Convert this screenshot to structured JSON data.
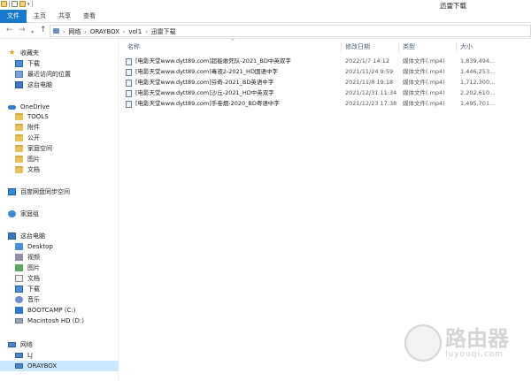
{
  "window": {
    "title": "迅雷下载"
  },
  "ribbon": {
    "tabs": [
      "文件",
      "主页",
      "共享",
      "查看"
    ]
  },
  "address": {
    "crumbs": [
      "网络",
      "ORAYBOX",
      "vol1",
      "迅雷下载"
    ]
  },
  "nav": {
    "favorites": {
      "label": "收藏夹",
      "items": [
        "下载",
        "最近访问的位置",
        "这台电脑"
      ]
    },
    "onedrive": {
      "label": "OneDrive",
      "items": [
        "TOOLS",
        "附件",
        "公开",
        "家庭空间",
        "图片",
        "文档"
      ]
    },
    "baidu": "百度网盘同步空间",
    "homegroup": "家庭组",
    "pc": {
      "label": "这台电脑",
      "items": [
        "Desktop",
        "视频",
        "图片",
        "文档",
        "下载",
        "音乐",
        "BOOTCAMP (C:)",
        "Macintosh HD (D:)"
      ]
    },
    "network": {
      "label": "网络",
      "items": [
        "LJ",
        "ORAYBOX"
      ]
    }
  },
  "columns": {
    "name": "名称",
    "date": "修改日期",
    "type": "类型",
    "size": "大小"
  },
  "files": [
    {
      "name": "[电影天堂www.dytt89.com]超能敢死队-2021_BD中英双字",
      "date": "2022/1/7 14:12",
      "type": "媒体文件(.mp4)",
      "size": "1,839,494..."
    },
    {
      "name": "[电影天堂www.dytt89.com]毒液2-2021_HD国语中字",
      "date": "2021/11/24 9:59",
      "type": "媒体文件(.mp4)",
      "size": "1,446,253..."
    },
    {
      "name": "[电影天堂www.dytt89.com]芬奇-2021_BD英语中字",
      "date": "2021/11/8 19:18",
      "type": "媒体文件(.mp4)",
      "size": "1,712,300..."
    },
    {
      "name": "[电影天堂www.dytt89.com]沙丘-2021_HD中英双字",
      "date": "2021/12/31 11:34",
      "type": "媒体文件(.mp4)",
      "size": "2,202,610..."
    },
    {
      "name": "[电影天堂www.dytt89.com]手卷烟-2020_BD粤语中字",
      "date": "2021/12/23 17:38",
      "type": "媒体文件(.mp4)",
      "size": "1,495,701..."
    }
  ],
  "watermark": {
    "cn": "路由器",
    "en": "luyouqi.com"
  }
}
